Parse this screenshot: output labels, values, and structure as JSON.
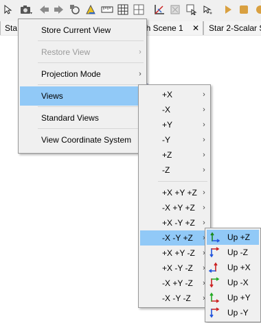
{
  "toolbar": {
    "icons": [
      "select-arrow-icon",
      "camera-icon",
      "back-arrow-icon",
      "forward-arrow-icon",
      "reset-view-icon",
      "scale-icon",
      "ruler-icon",
      "grid-icon",
      "mesh-grid-icon",
      "axes-icon",
      "fit-view-icon",
      "rotate-icon",
      "zoom-icon",
      "play-icon",
      "stop-icon",
      "record-icon"
    ]
  },
  "tabs": [
    {
      "label": "Sta"
    },
    {
      "label": "esh Scene 1",
      "close": "✕"
    },
    {
      "label": "Star 2-Scalar Sc"
    }
  ],
  "main_menu": {
    "items": [
      {
        "label": "Store Current View",
        "has_submenu": false,
        "enabled": true
      },
      {
        "label": "Restore View",
        "has_submenu": true,
        "enabled": false
      },
      {
        "label": "Projection Mode",
        "has_submenu": true,
        "enabled": true
      },
      {
        "label": "Views",
        "has_submenu": true,
        "enabled": true,
        "highlighted": true
      },
      {
        "label": "Standard Views",
        "has_submenu": true,
        "enabled": true
      },
      {
        "label": "View Coordinate System",
        "has_submenu": true,
        "enabled": true
      }
    ],
    "submenu_arrow": "›"
  },
  "views_menu": {
    "items": [
      {
        "label": "+X"
      },
      {
        "label": "-X"
      },
      {
        "label": "+Y"
      },
      {
        "label": "-Y"
      },
      {
        "label": "+Z"
      },
      {
        "label": "-Z"
      },
      {
        "label": "+X +Y +Z"
      },
      {
        "label": "-X +Y +Z"
      },
      {
        "label": "+X -Y +Z"
      },
      {
        "label": "-X -Y +Z",
        "highlighted": true
      },
      {
        "label": "+X +Y -Z"
      },
      {
        "label": "+X -Y -Z"
      },
      {
        "label": "-X +Y -Z"
      },
      {
        "label": "-X -Y -Z"
      }
    ]
  },
  "up_menu": {
    "items": [
      {
        "label": "Up +Z",
        "icon": "up-plus-z-icon",
        "highlighted": true,
        "colors": [
          "#1a8a1a",
          "#2255dd"
        ]
      },
      {
        "label": "Up -Z",
        "icon": "up-minus-z-icon",
        "colors": [
          "#cc2222",
          "#2255dd"
        ]
      },
      {
        "label": "Up +X",
        "icon": "up-plus-x-icon",
        "colors": [
          "#cc2222",
          "#2255dd"
        ]
      },
      {
        "label": "Up -X",
        "icon": "up-minus-x-icon",
        "colors": [
          "#cc2222",
          "#22aa22"
        ]
      },
      {
        "label": "Up +Y",
        "icon": "up-plus-y-icon",
        "colors": [
          "#22aa22",
          "#cc2222"
        ]
      },
      {
        "label": "Up -Y",
        "icon": "up-minus-y-icon",
        "colors": [
          "#2255dd",
          "#cc2222"
        ]
      }
    ]
  },
  "colors": {
    "highlight": "#91c9f7",
    "menu_bg": "#f0f0f0",
    "border": "#979797"
  }
}
